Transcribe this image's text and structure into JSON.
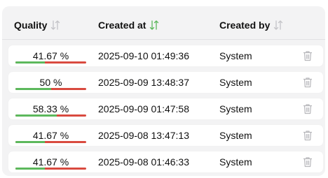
{
  "table": {
    "headers": [
      {
        "label": "Quality",
        "sort_icon": "sort-icon",
        "active": false
      },
      {
        "label": "Created at",
        "sort_icon": "sort-icon",
        "active": true
      },
      {
        "label": "Created by",
        "sort_icon": "sort-icon",
        "active": false
      }
    ],
    "rows": [
      {
        "quality_label": "41.67 %",
        "quality": 0.4167,
        "created_at": "2025-09-10 01:49:36",
        "created_by": "System"
      },
      {
        "quality_label": "50 %",
        "quality": 0.5,
        "created_at": "2025-09-09 13:48:37",
        "created_by": "System"
      },
      {
        "quality_label": "58.33 %",
        "quality": 0.5833,
        "created_at": "2025-09-09 01:47:58",
        "created_by": "System"
      },
      {
        "quality_label": "41.67 %",
        "quality": 0.4167,
        "created_at": "2025-09-08 13:47:13",
        "created_by": "System"
      },
      {
        "quality_label": "41.67 %",
        "quality": 0.4167,
        "created_at": "2025-09-08 01:46:33",
        "created_by": "System"
      }
    ]
  },
  "colors": {
    "quality_good": "#5cb85c",
    "quality_bad": "#d94a3f",
    "sort_active": "#5cb85c",
    "sort_inactive": "#c4c4c8",
    "trash": "#b8b8bc"
  },
  "icons": {
    "delete": "trash-icon"
  }
}
